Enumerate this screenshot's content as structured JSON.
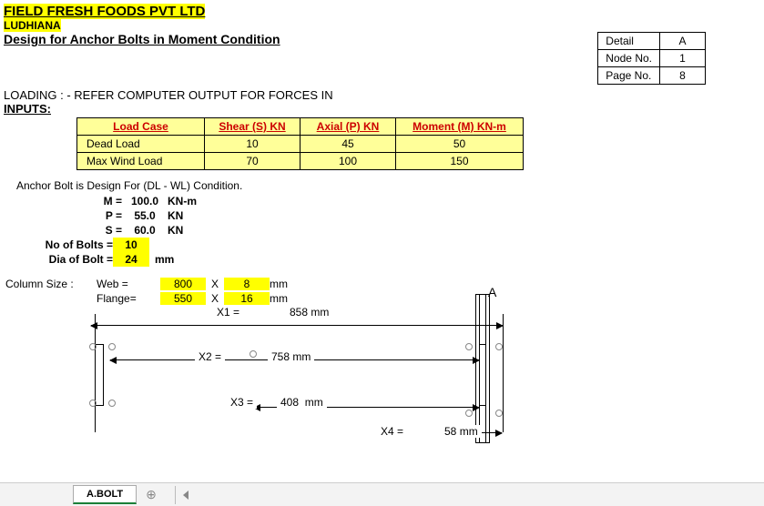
{
  "header": {
    "company": "FIELD FRESH FOODS PVT LTD",
    "location": "LUDHIANA",
    "doc_title": "Design for Anchor Bolts in Moment Condition"
  },
  "detail_box": {
    "rows": [
      {
        "label": "Detail",
        "value": "A"
      },
      {
        "label": "Node No.",
        "value": "1"
      },
      {
        "label": "Page No.",
        "value": "8"
      }
    ]
  },
  "loading_line": "LOADING : - REFER COMPUTER OUTPUT  FOR FORCES IN",
  "inputs_label": "INPUTS:",
  "loads_table": {
    "headers": [
      "Load Case",
      "Shear (S) KN",
      "Axial (P) KN",
      "Moment (M) KN-m"
    ],
    "rows": [
      {
        "label": "Dead Load",
        "shear": "10",
        "axial": "45",
        "moment": "50"
      },
      {
        "label": "Max Wind Load",
        "shear": "70",
        "axial": "100",
        "moment": "150"
      }
    ]
  },
  "condition_text": "Anchor Bolt is Design For (DL - WL)  Condition.",
  "design_values": {
    "M": {
      "value": "100.0",
      "unit": "KN-m"
    },
    "P": {
      "value": "55.0",
      "unit": "KN"
    },
    "S": {
      "value": "60.0",
      "unit": "KN"
    }
  },
  "bolts": {
    "no_label": "No of Bolts =",
    "no_value": "10",
    "dia_label": "Dia of  Bolt =",
    "dia_value": "24",
    "dia_unit": "mm"
  },
  "column_size": {
    "label": "Column Size :",
    "web_label": "Web  =",
    "web_w": "800",
    "web_t": "8",
    "flange_label": "Flange=",
    "flange_w": "550",
    "flange_t": "16",
    "x": "X",
    "unit": "mm"
  },
  "diagram": {
    "a_label": "A",
    "dims": {
      "x1": {
        "label": "X1 =",
        "value": "858",
        "unit": "mm"
      },
      "x2": {
        "label": "X2 =",
        "value": "758",
        "unit": "mm"
      },
      "x3": {
        "label": "X3 =",
        "value": "408",
        "unit": "mm"
      },
      "x4": {
        "label": "X4 =",
        "value": "58",
        "unit": "mm"
      }
    }
  },
  "sheet_tab": "A.BOLT"
}
